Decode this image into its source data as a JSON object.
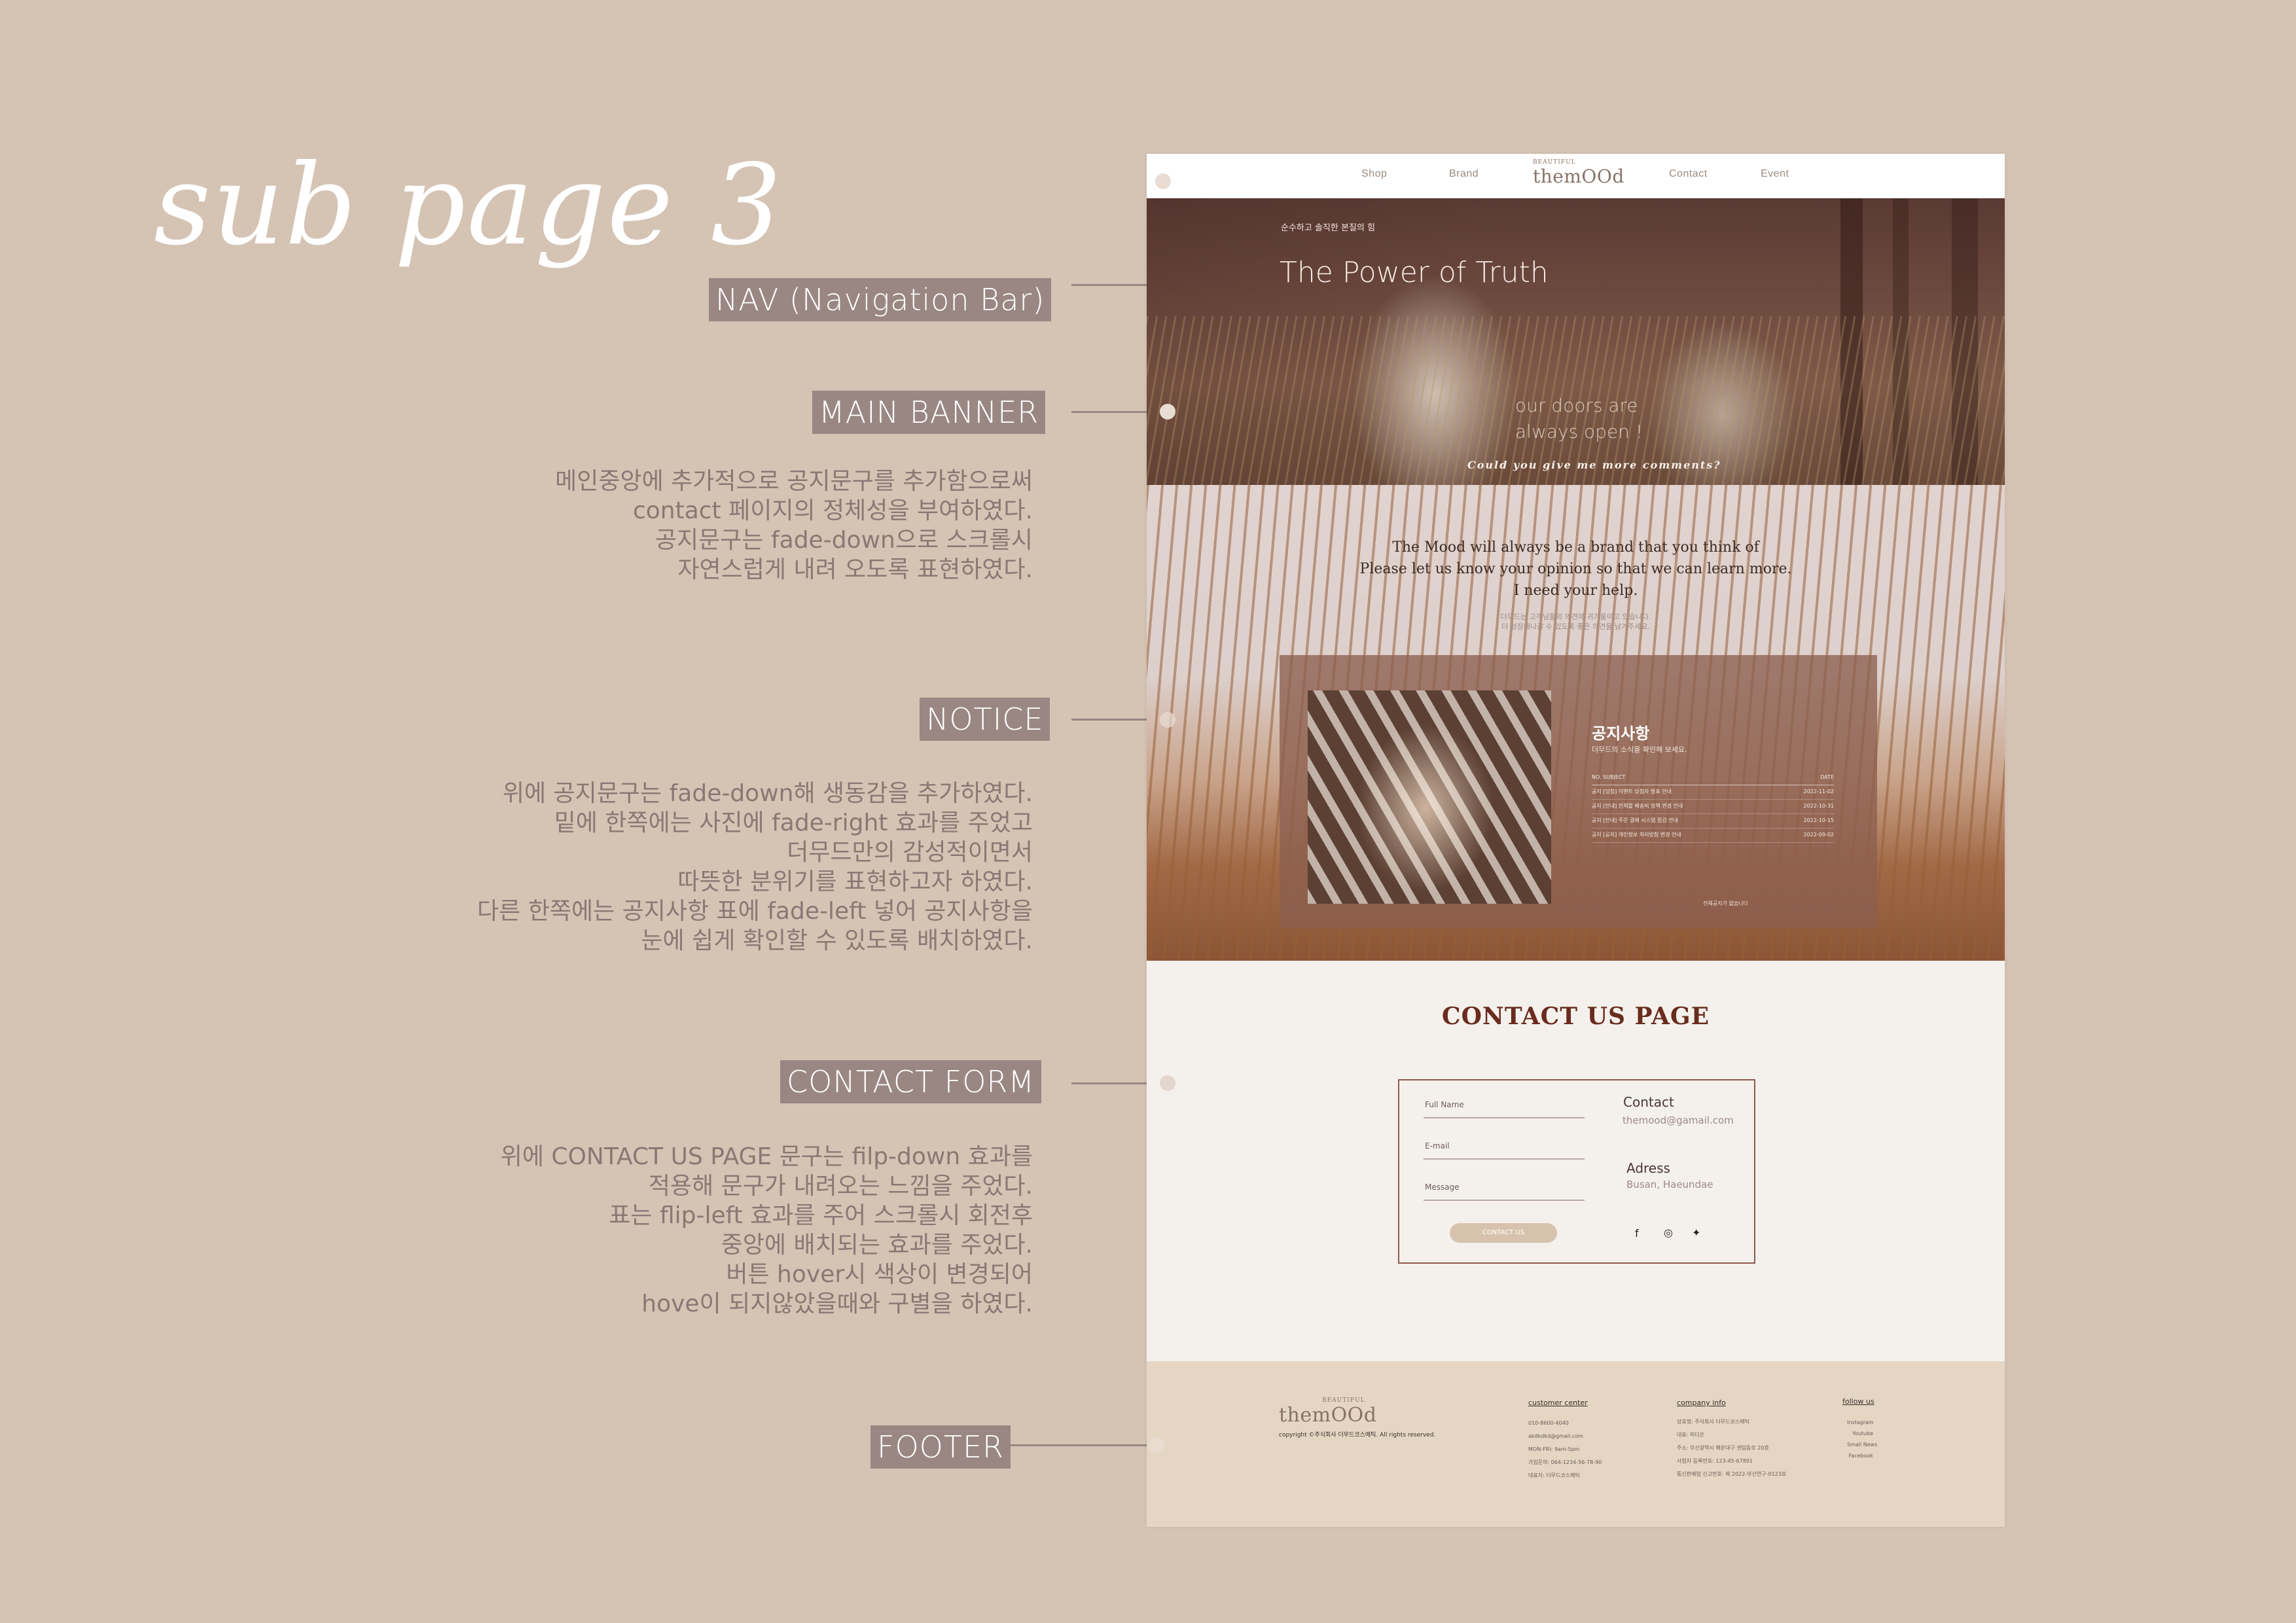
{
  "page_title": "sub page 3",
  "sections": {
    "nav": {
      "tag": "NAV (Navigation Bar)"
    },
    "banner": {
      "tag": "MAIN BANNER",
      "desc": [
        "메인중앙에 추가적으로 공지문구를 추가함으로써",
        "contact 페이지의 정체성을 부여하였다.",
        "공지문구는 fade-down으로 스크롤시",
        "자연스럽게 내려 오도록 표현하였다."
      ]
    },
    "notice": {
      "tag": "NOTICE",
      "desc": [
        "위에 공지문구는 fade-down해 생동감을 추가하였다.",
        "밑에 한쪽에는 사진에 fade-right 효과를 주었고",
        "더무드만의 감성적이면서",
        "따뜻한 분위기를 표현하고자 하였다.",
        "다른 한쪽에는 공지사항 표에 fade-left 넣어 공지사항을",
        "눈에 쉽게 확인할 수 있도록 배치하였다."
      ]
    },
    "contact": {
      "tag": "CONTACT FORM",
      "desc": [
        "위에 CONTACT US PAGE 문구는 filp-down 효과를",
        "적용해 문구가 내려오는 느낌을 주었다.",
        "표는 flip-left 효과를 주어 스크롤시 회전후",
        "중앙에 배치되는 효과를 주었다.",
        "버튼 hover시 색상이 변경되어",
        "hove이 되지않았을때와 구별을 하였다."
      ]
    },
    "footer": {
      "tag": "FOOTER"
    }
  },
  "mock": {
    "nav": {
      "items": [
        "Shop",
        "Brand",
        "Contact",
        "Event"
      ],
      "logo": "themOOd",
      "logo_sub": "BEAUTIFUL"
    },
    "banner": {
      "kicker": "순수하고 솔직한 본질의 힘",
      "title": "The Power of Truth",
      "line1": "our doors are",
      "line2": "always open !",
      "ask": "Could you give me more comments?"
    },
    "notice": {
      "copy": [
        "The Mood will always be a brand that you think of",
        "Please let us know your opinion so that we can learn more.",
        "I need your help."
      ],
      "small": [
        "더무드는 고객님들의 의견에 귀기울이고 있습니다.",
        "더 성장해나갈 수 있도록 좋은 의견을 남겨주세요."
      ],
      "title": "공지사항",
      "subtitle": "더무드의 소식을 확인해 보세요.",
      "table_head": [
        "NO. SUBJECT",
        "DATE"
      ],
      "rows": [
        {
          "subject": "공지 [당첨] 이벤트 당첨자 발표 안내",
          "date": "2022-11-02"
        },
        {
          "subject": "공지 [안내] 전체몰 배송비 정책 변경 안내",
          "date": "2022-10-31"
        },
        {
          "subject": "공지 [안내] 주문 결제 시스템 점검 안내",
          "date": "2022-10-15"
        },
        {
          "subject": "공지 [공지] 개인정보 처리방침 변경 안내",
          "date": "2022-09-02"
        }
      ],
      "more": "전체공지가 없습니다"
    },
    "contact": {
      "title": "CONTACT US PAGE",
      "fields": [
        "Full Name",
        "E-mail",
        "Message"
      ],
      "button": "CONTACT US",
      "contact_head": "Contact",
      "contact_val": "themood@gamail.com",
      "address_head": "Adress",
      "address_val": "Busan, Haeundae",
      "social": [
        "f",
        "◎",
        "✦"
      ]
    },
    "footer": {
      "logo": "themOOd",
      "logo_sub": "BEAUTIFUL",
      "copyright": "copyright ©주식회사 더무드코스메틱. All rights reserved.",
      "customer_head": "customer center",
      "customer": [
        "010-8600-4040",
        "akdkdkd@gmail.com",
        "MON-FRI: 9am-5pm",
        "",
        "가입문의: 064-1234-56-78-90",
        "대표자: 더무드코스메틱"
      ],
      "company_head": "company info",
      "company": [
        "상호명: 주식회사 더무드코스메틱",
        "대표: 허다은",
        "주소: 부산광역시 해운대구 센텀동로 20층",
        "사업자 등록번호: 123-45-67891",
        "통신판매업 신고번호: 제 2022-부산연구-0123호"
      ],
      "follow_head": "follow us",
      "follow": [
        "Instagram",
        "Youtube",
        "Small News",
        "Facebook"
      ]
    }
  }
}
